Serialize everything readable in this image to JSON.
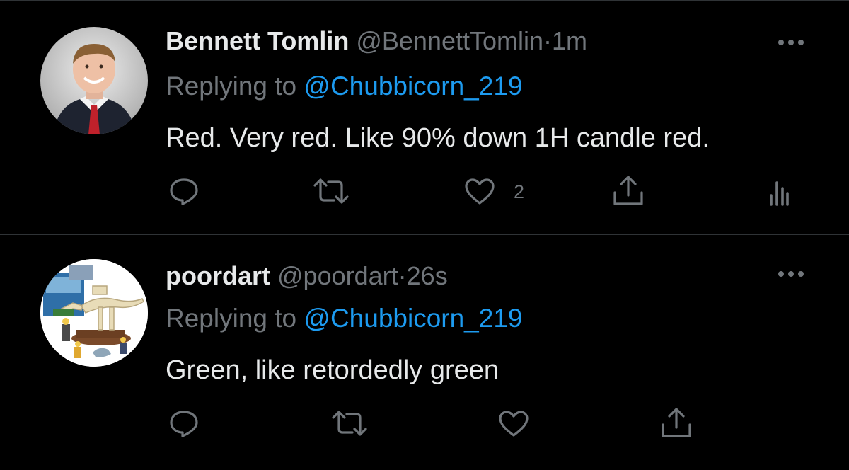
{
  "tweets": [
    {
      "name": "Bennett Tomlin",
      "handle": "@BennettTomlin",
      "separator": "·",
      "time": "1m",
      "replying_prefix": "Replying to",
      "replying_to": "@Chubbicorn_219",
      "text": "Red. Very red. Like 90% down 1H candle red.",
      "like_count": "2",
      "avatar_icon": "profile-photo",
      "actions": [
        "reply-icon",
        "retweet-icon",
        "like-icon",
        "share-icon",
        "analytics-icon"
      ]
    },
    {
      "name": "poordart",
      "handle": "@poordart",
      "separator": "·",
      "time": "26s",
      "replying_prefix": "Replying to",
      "replying_to": "@Chubbicorn_219",
      "text": "Green, like retordedly green",
      "avatar_icon": "lego-dinosaur-picture",
      "actions": [
        "reply-icon",
        "retweet-icon",
        "like-icon",
        "share-icon"
      ]
    }
  ],
  "colors": {
    "background": "#000000",
    "primary_text": "#e7e9ea",
    "secondary_text": "#71767b",
    "accent": "#1d9bf0",
    "divider": "#2f3336"
  }
}
